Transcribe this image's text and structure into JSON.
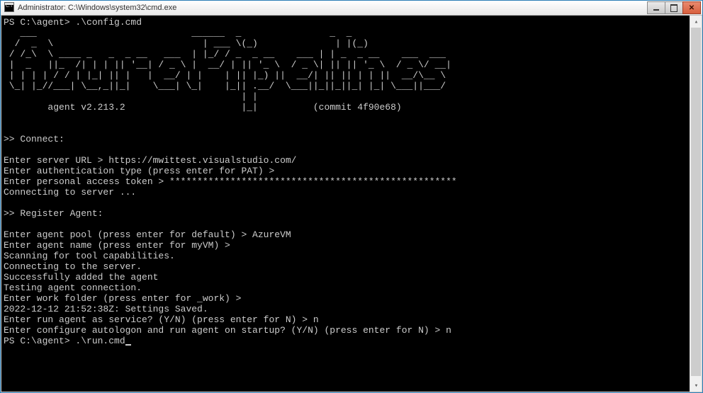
{
  "window": {
    "title": "Administrator: C:\\Windows\\system32\\cmd.exe"
  },
  "terminal": {
    "prompt1": "PS C:\\agent> .\\config.cmd",
    "ascii_art": "   ___                            ______  _                _  _\n  /  _  \\                           | ___ \\(_)              | |(_)\n / /_\\  \\ ____ _   _  _ __   ___  | |_/ / _  _ __    ___ | | _  _ __    ___  ___\n |  _   ||_  /| | | || '__| / _ \\ |  __/ | || '_ \\  / _ \\| || || '_ \\  / _ \\/ __|\n | | | | / / | |_| || |   |  __/ | |    | || |_) ||  __/| || || | | ||  __/\\__ \\\n \\_| |_//___| \\__,_||_|    \\___| \\_|    |_|| .__/  \\___||_||_||_| |_| \\___||___/\n                                           | |\n        agent v2.213.2                     |_|          (commit 4f90e68)",
    "connect_header": ">> Connect:",
    "enter_server_url": "Enter server URL > https://mwittest.visualstudio.com/",
    "enter_auth_type": "Enter authentication type (press enter for PAT) >",
    "enter_pat": "Enter personal access token > ****************************************************",
    "connecting": "Connecting to server ...",
    "register_header": ">> Register Agent:",
    "enter_pool": "Enter agent pool (press enter for default) > AzureVM",
    "enter_agent_name": "Enter agent name (press enter for myVM) >",
    "scanning": "Scanning for tool capabilities.",
    "connecting_server": "Connecting to the server.",
    "added": "Successfully added the agent",
    "testing": "Testing agent connection.",
    "work_folder": "Enter work folder (press enter for _work) >",
    "settings_saved": "2022-12-12 21:52:38Z: Settings Saved.",
    "run_service": "Enter run agent as service? (Y/N) (press enter for N) > n",
    "autologon": "Enter configure autologon and run agent on startup? (Y/N) (press enter for N) > n",
    "prompt2": "PS C:\\agent> .\\run.cmd"
  }
}
